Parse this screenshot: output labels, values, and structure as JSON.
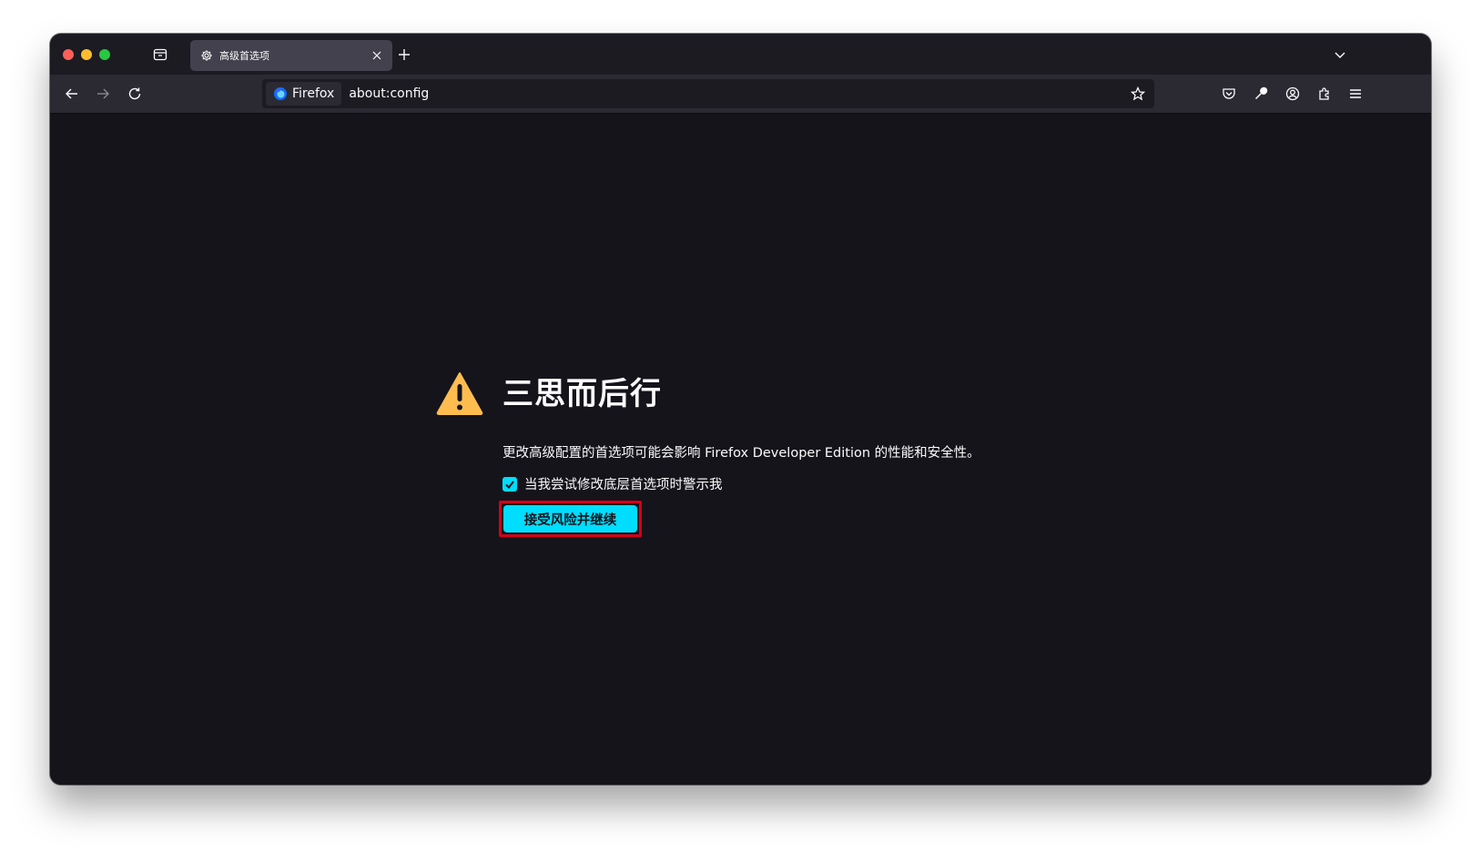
{
  "window": {
    "traffic_lights": {
      "close_color": "#fe5f57",
      "minimize_color": "#febc2e",
      "maximize_color": "#28c840"
    }
  },
  "tab": {
    "title": "高级首选项",
    "icon": "gear-icon"
  },
  "navbar": {
    "identity_label": "Firefox",
    "url": "about:config"
  },
  "icons": {
    "sidebar": "sidebar-icon",
    "new_tab": "plus-icon",
    "tab_list": "chevron-down-icon",
    "back": "back-arrow-icon",
    "forward": "forward-arrow-icon",
    "reload": "reload-icon",
    "bookmark": "star-icon",
    "pocket": "pocket-icon",
    "devtools": "wrench-icon",
    "account": "account-icon",
    "extensions": "puzzle-icon",
    "menu": "hamburger-menu-icon"
  },
  "warning": {
    "title": "三思而后行",
    "description": "更改高级配置的首选项可能会影响 Firefox Developer Edition 的性能和安全性。",
    "checkbox_label": "当我尝试修改底层首选项时警示我",
    "checkbox_checked": true,
    "accept_button": "接受风险并继续"
  },
  "colors": {
    "accent": "#00ddff",
    "warning_yellow": "#ffbd4f",
    "highlight_red": "#d40018",
    "background": "#15141a"
  }
}
